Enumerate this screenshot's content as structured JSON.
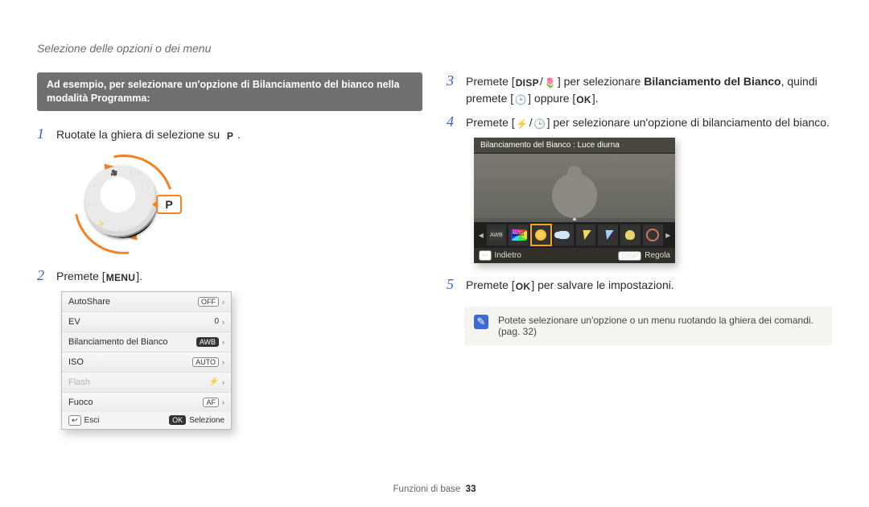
{
  "header": {
    "breadcrumb": "Selezione delle opzioni o dei menu"
  },
  "example_bar": "Ad esempio, per selezionare un'opzione di Bilanciamento del bianco nella modalità Programma:",
  "steps": {
    "s1": {
      "num": "1",
      "text_a": "Ruotate la ghiera di selezione su ",
      "icon": "P",
      "text_b": "."
    },
    "s2": {
      "num": "2",
      "text_a": "Premete [",
      "icon": "MENU",
      "text_b": "]."
    },
    "s3": {
      "num": "3",
      "text_a": "Premete [",
      "icon1": "DISP",
      "slash": "/",
      "icon2": "🌷",
      "text_b": "] per selezionare ",
      "bold": "Bilanciamento del Bianco",
      "text_c": ", quindi premete [",
      "icon3": "🕒",
      "text_d": "] oppure [",
      "icon4": "OK",
      "text_e": "]."
    },
    "s4": {
      "num": "4",
      "text_a": "Premete [",
      "icon1": "⚡",
      "slash": "/",
      "icon2": "🕒",
      "text_b": "] per selezionare un'opzione di bilanciamento del bianco."
    },
    "s5": {
      "num": "5",
      "text_a": "Premete [",
      "icon": "OK",
      "text_b": "] per salvare le impostazioni."
    }
  },
  "dial": {
    "highlight": "P"
  },
  "menu": {
    "rows": [
      {
        "label": "AutoShare",
        "value": "OFF",
        "arrow": "›"
      },
      {
        "label": "EV",
        "value": "0",
        "arrow": "›"
      },
      {
        "label": "Bilanciamento del Bianco",
        "value": "AWB",
        "arrow": "›"
      },
      {
        "label": "ISO",
        "value": "AUTO",
        "arrow": "›"
      },
      {
        "label": "Flash",
        "value": "⚡",
        "arrow": "›",
        "disabled": true
      },
      {
        "label": "Fuoco",
        "value": "AF",
        "arrow": "›"
      }
    ],
    "footer": {
      "back_key": "↩",
      "back_label": "Esci",
      "ok_key": "OK",
      "ok_label": "Selezione"
    }
  },
  "wb": {
    "title": "Bilanciamento del Bianco : Luce diurna",
    "footer": {
      "back_key": "↩",
      "back_label": "Indietro",
      "adj_key": "DISP",
      "adj_label": "Regola"
    }
  },
  "note": {
    "icon": "✎",
    "text": "Potete selezionare un'opzione o un menu ruotando la ghiera dei comandi. (pag. 32)"
  },
  "footer": {
    "section": "Funzioni di base",
    "page": "33"
  }
}
